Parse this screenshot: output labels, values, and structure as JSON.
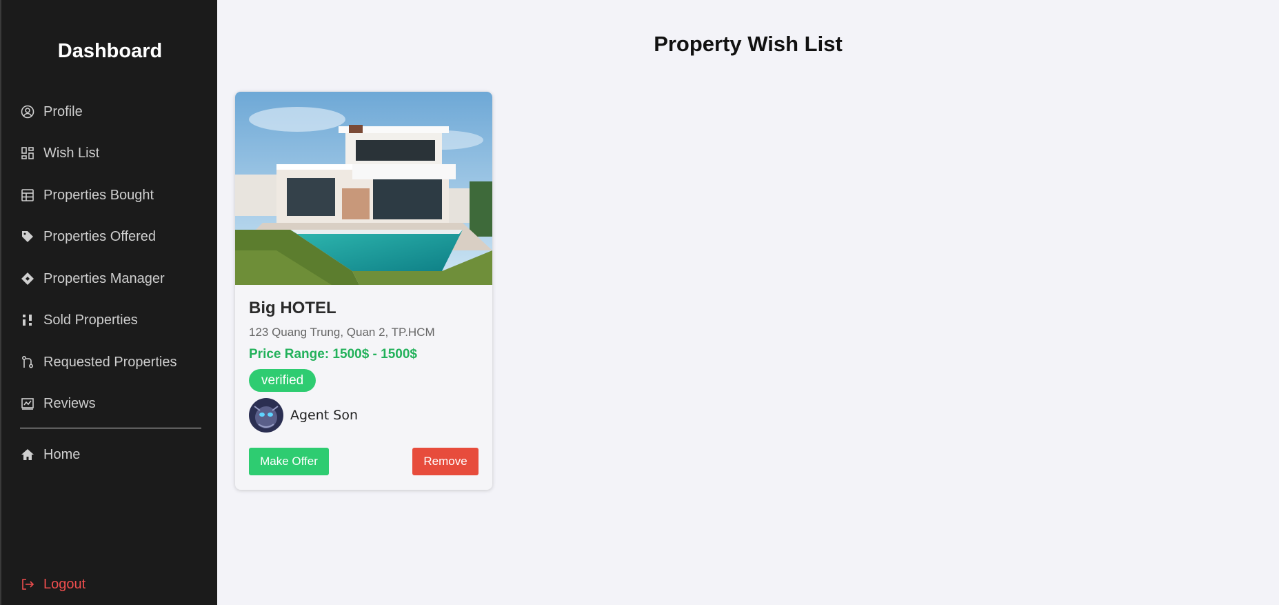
{
  "sidebar": {
    "title": "Dashboard",
    "items": [
      {
        "label": "Profile",
        "icon": "user-circle-icon"
      },
      {
        "label": "Wish List",
        "icon": "dashboard-grid-icon"
      },
      {
        "label": "Properties Bought",
        "icon": "table-icon"
      },
      {
        "label": "Properties Offered",
        "icon": "tag-icon"
      },
      {
        "label": "Properties Manager",
        "icon": "diamond-icon"
      },
      {
        "label": "Sold Properties",
        "icon": "sort-icon"
      },
      {
        "label": "Requested Properties",
        "icon": "git-pull-icon"
      },
      {
        "label": "Reviews",
        "icon": "chart-board-icon"
      }
    ],
    "home_label": "Home",
    "logout_label": "Logout"
  },
  "main": {
    "title": "Property Wish List"
  },
  "card": {
    "title": "Big HOTEL",
    "address": "123 Quang Trung, Quan 2, TP.HCM",
    "price": "Price Range: 1500$ - 1500$",
    "status": "verified",
    "agent_name": "Agent Son",
    "make_offer_label": "Make Offer",
    "remove_label": "Remove"
  },
  "colors": {
    "sidebar_bg": "#1b1b1b",
    "price_green": "#22b15a",
    "badge_green": "#2ecc71",
    "remove_red": "#e74c3c",
    "logout_red": "#ef4e4e"
  }
}
